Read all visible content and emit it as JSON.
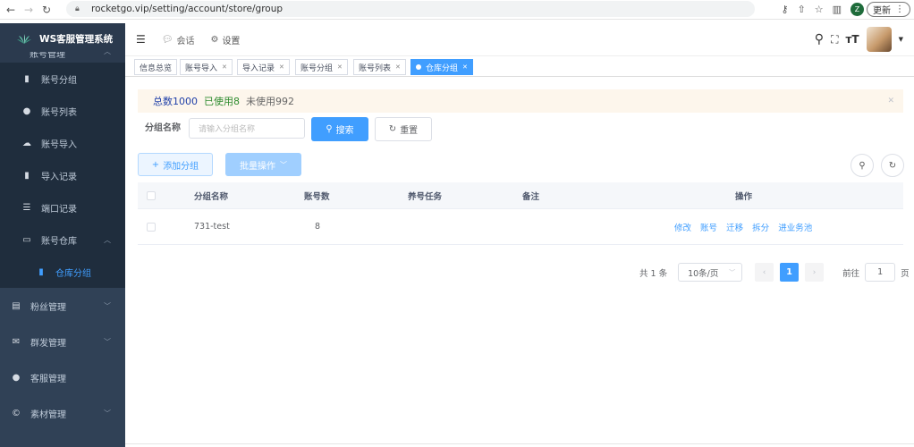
{
  "browser": {
    "url": "rocketgo.vip/setting/account/store/group",
    "avatar_letter": "Z",
    "update_label": "更新"
  },
  "sidebar": {
    "brand": "WS客服管理系统",
    "hidden_item": "账号管理",
    "items": [
      {
        "label": "账号分组",
        "icon": "bar-chart-icon"
      },
      {
        "label": "账号列表",
        "icon": "user-icon"
      },
      {
        "label": "账号导入",
        "icon": "cloud-upload-icon"
      },
      {
        "label": "导入记录",
        "icon": "bar-chart-icon"
      },
      {
        "label": "端口记录",
        "icon": "list-icon"
      },
      {
        "label": "账号仓库",
        "icon": "monitor-icon"
      },
      {
        "label": "仓库分组",
        "icon": "bar-chart-icon"
      },
      {
        "label": "粉丝管理",
        "icon": "sofa-icon"
      },
      {
        "label": "群发管理",
        "icon": "mail-icon"
      },
      {
        "label": "客服管理",
        "icon": "user-icon"
      },
      {
        "label": "素材管理",
        "icon": "copyright-icon"
      }
    ]
  },
  "header": {
    "tabs": [
      {
        "label": "会话",
        "icon": "chat-icon"
      },
      {
        "label": "设置",
        "icon": "gear-icon"
      }
    ]
  },
  "tags": [
    {
      "label": "信息总览"
    },
    {
      "label": "账号导入"
    },
    {
      "label": "导入记录"
    },
    {
      "label": "账号分组"
    },
    {
      "label": "账号列表"
    },
    {
      "label": "仓库分组",
      "active": true
    }
  ],
  "alert": {
    "total": "总数1000",
    "used": "已使用8",
    "unused": "未使用992"
  },
  "search": {
    "label": "分组名称",
    "placeholder": "请输入分组名称",
    "search_btn": "搜索",
    "reset_btn": "重置"
  },
  "toolbar": {
    "add_btn": "添加分组",
    "batch_btn": "批量操作"
  },
  "table": {
    "headers": [
      "分组名称",
      "账号数",
      "养号任务",
      "备注",
      "操作"
    ],
    "rows": [
      {
        "name": "731-test",
        "count": "8",
        "task": "",
        "note": "",
        "actions": [
          "修改",
          "账号",
          "迁移",
          "拆分",
          "进业务池"
        ]
      }
    ]
  },
  "pagination": {
    "total": "共 1 条",
    "page_size": "10条/页",
    "current_page": "1",
    "goto_label": "前往",
    "goto_value": "1",
    "page_unit": "页"
  },
  "colors": {
    "sidebar_bg": "#304156",
    "primary": "#409eff",
    "alert_bg": "#fdf6ec"
  }
}
